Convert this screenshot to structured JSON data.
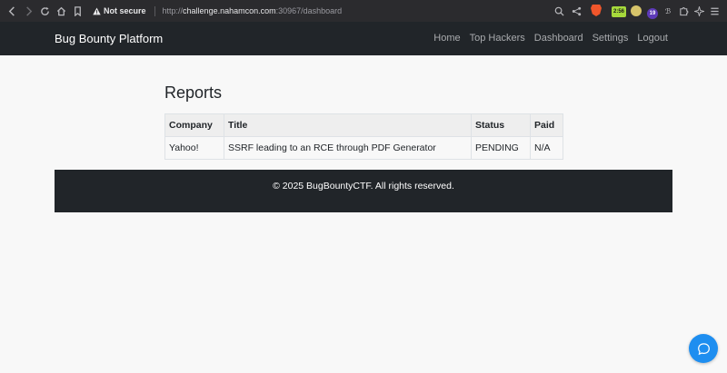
{
  "browser": {
    "security_label": "Not secure",
    "url_prefix": "http://",
    "url_host": "challenge.nahamcon.com",
    "url_rest": ":30967/dashboard",
    "ext_badge_text": "2:56",
    "ext_count": "19"
  },
  "navbar": {
    "brand": "Bug Bounty Platform",
    "links": [
      "Home",
      "Top Hackers",
      "Dashboard",
      "Settings",
      "Logout"
    ]
  },
  "reports": {
    "heading": "Reports",
    "columns": [
      "Company",
      "Title",
      "Status",
      "Paid"
    ],
    "rows": [
      [
        "Yahoo!",
        "SSRF leading to an RCE through PDF Generator",
        "PENDING",
        "N/A"
      ]
    ]
  },
  "footer": {
    "text": "© 2025 BugBountyCTF. All rights reserved."
  },
  "colors": {
    "navbar_bg": "#212529",
    "page_bg": "#f8f8f8",
    "chat_button": "#1e8ef0"
  },
  "icons": [
    "back-icon",
    "forward-icon",
    "reload-icon",
    "home-icon",
    "bookmark-icon",
    "warning-icon",
    "zoom-icon",
    "share-icon",
    "brave-shield-icon",
    "puzzle-icon",
    "sparkle-icon",
    "menu-icon",
    "chat-icon"
  ]
}
